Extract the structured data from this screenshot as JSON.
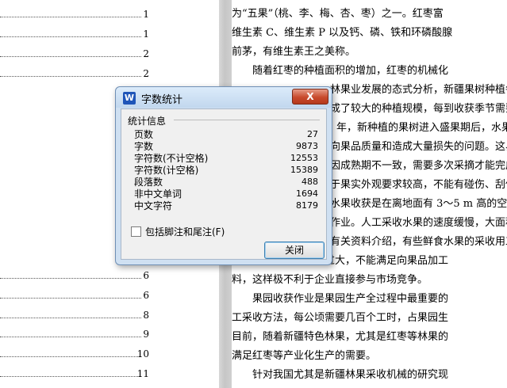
{
  "toc": {
    "numbers": [
      "1",
      "1",
      "2",
      "2",
      "6",
      "6",
      "8",
      "9",
      "10",
      "11"
    ]
  },
  "document": {
    "lines": [
      "为“五果”（桃、李、梅、杏、枣）之一。红枣富",
      "维生素 C、维生素 P 以及钙、磷、铁和环磷酸腺",
      "前茅，有维生素王之美称。",
      "随着红枣的种植面积的增加，红枣的机械化",
      "林果业发展的态式分析，新疆果树种植每",
      "成了较大的种植规模，每到收获季节需要",
      "年，新种植的果树进入盛果期后，水果",
      "向果品质量和造成大量损失的问题。这易",
      "因成熟期不一致，需要多次采摘才能完成",
      "于果实外观要求较高，不能有碰伤、刮伤",
      "水果收获是在离地面有 3～5 m 高的空中",
      "作业。人工采收水果的速度缓慢，大面积",
      "有关资料介绍，有些鲜食水果的采收用工",
      "特色果品的生产成本过大，不能满足向果品加工",
      "料，这样极不利于企业直接参与市场竞争。",
      "果园收获作业是果园生产全过程中最重要的",
      "工采收方法，每公顷需要几百个工时，占果园生",
      "目前，随着新疆特色林果，尤其是红枣等林果的",
      "满足红枣等产业化生产的需要。",
      "针对我国尤其是新疆林果采收机械的研究现"
    ]
  },
  "dialog": {
    "app_icon": "W",
    "title": "字数统计",
    "close_x": "X",
    "group_title": "统计信息",
    "stats": [
      {
        "label": "页数",
        "value": "27"
      },
      {
        "label": "字数",
        "value": "9873"
      },
      {
        "label": "字符数(不计空格)",
        "value": "12553"
      },
      {
        "label": "字符数(计空格)",
        "value": "15389"
      },
      {
        "label": "段落数",
        "value": "488"
      },
      {
        "label": "非中文单词",
        "value": "1694"
      },
      {
        "label": "中文字符",
        "value": "8179"
      }
    ],
    "checkbox_label": "包括脚注和尾注(F)",
    "checkbox_checked": false,
    "close_button": "关闭"
  },
  "colors": {
    "dialog_frame": "#cfe0f2",
    "close_x": "#c84a2c",
    "button_border": "#3c7fb1"
  }
}
